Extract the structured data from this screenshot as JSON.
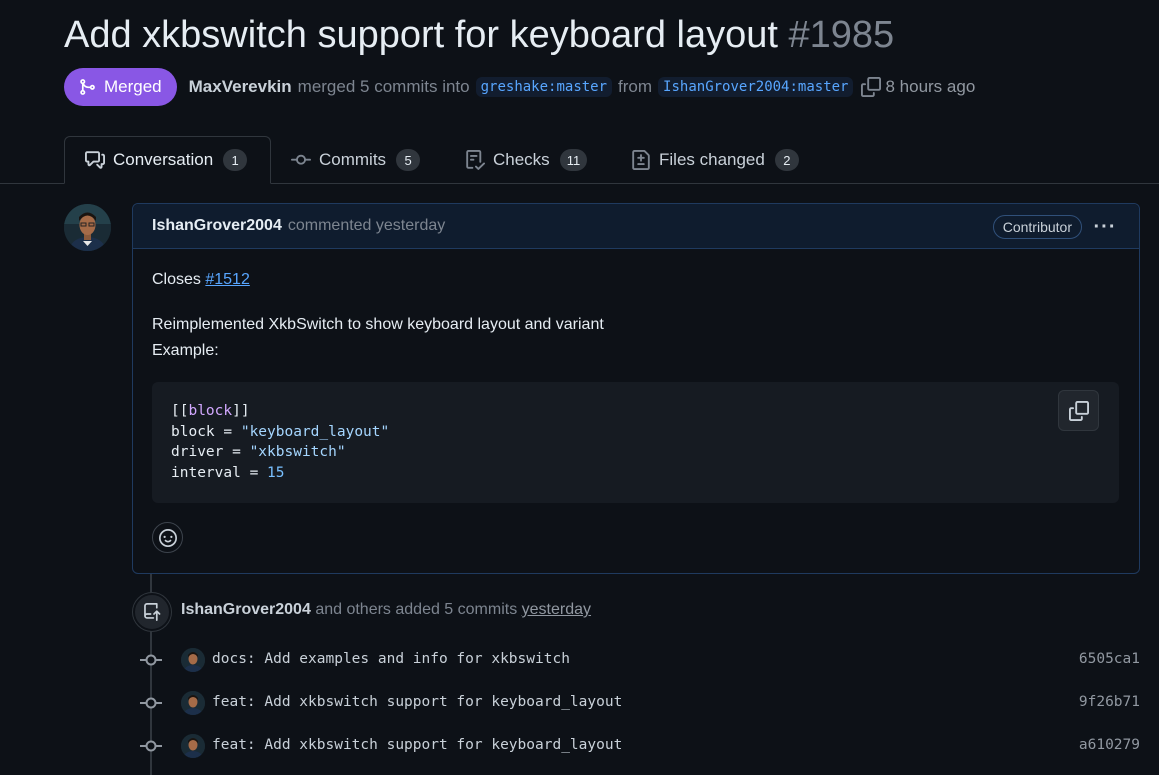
{
  "pr": {
    "title": "Add xkbswitch support for keyboard layout",
    "number": "#1985",
    "state_label": "Merged",
    "merged_by": "MaxVerevkin",
    "merge_text": "merged 5 commits into",
    "base_branch": "greshake:master",
    "from_text": "from",
    "head_branch": "IshanGrover2004:master",
    "time_ago": "8 hours ago"
  },
  "tabs": [
    {
      "label": "Conversation",
      "count": "1",
      "icon": "comment-discussion-icon"
    },
    {
      "label": "Commits",
      "count": "5",
      "icon": "git-commit-icon"
    },
    {
      "label": "Checks",
      "count": "11",
      "icon": "checklist-icon"
    },
    {
      "label": "Files changed",
      "count": "2",
      "icon": "file-diff-icon"
    }
  ],
  "comment": {
    "author": "IshanGrover2004",
    "action": "commented yesterday",
    "badge": "Contributor",
    "closes_text": "Closes",
    "issue_link": "#1512",
    "line1": "Reimplemented XkbSwitch to show keyboard layout and variant",
    "line2": "Example:",
    "code": {
      "l1_open": "[[",
      "l1_kw": "block",
      "l1_close": "]]",
      "l2_key": "block = ",
      "l2_val": "\"keyboard_layout\"",
      "l3_key": "driver = ",
      "l3_val": "\"xkbswitch\"",
      "l4_key": "interval = ",
      "l4_val": "15"
    }
  },
  "event": {
    "author": "IshanGrover2004",
    "text": "and others added 5 commits",
    "time": "yesterday"
  },
  "commits": [
    {
      "message": "docs: Add examples and info for xkbswitch",
      "sha": "6505ca1"
    },
    {
      "message": "feat: Add xkbswitch support for keyboard_layout",
      "sha": "9f26b71"
    },
    {
      "message": "feat: Add xkbswitch support for keyboard_layout",
      "sha": "a610279"
    }
  ],
  "colors": {
    "merged": "#8957e5",
    "link": "#58a6ff",
    "background": "#0d1117"
  }
}
